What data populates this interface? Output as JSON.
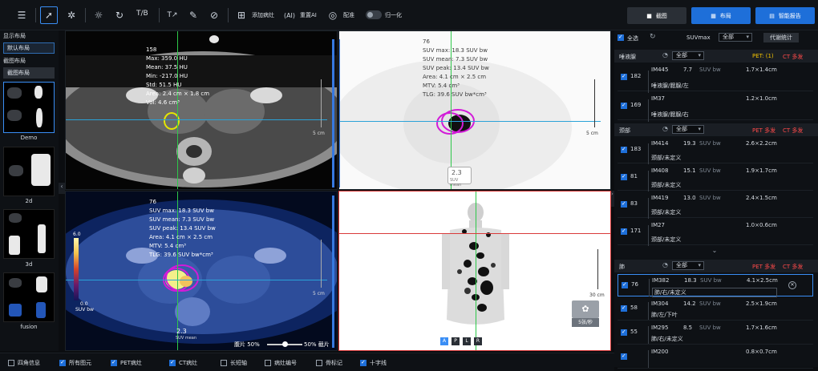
{
  "toolbar": {
    "icons": [
      "list-icon",
      "cursor-icon",
      "brightness-icon",
      "adjust-icon",
      "rotate-icon"
    ],
    "tb_label": "T/B",
    "add_lesion": "添加病灶",
    "reset_ai": "重置AI",
    "compare": "配准",
    "normalize": "归一化",
    "screenshot": "截图",
    "layout": "布局",
    "report": "智能报告",
    "colors": {
      "report_button": "#1e6fd9",
      "layout_button": "#1e6fd9",
      "dark_button": "#2a2f36"
    }
  },
  "left_panel": {
    "display_layout_title": "显示布局",
    "default_layout": "默认布局",
    "screenshot_layout_title": "截图布局",
    "screenshot_layout": "截图布局",
    "thumbs": [
      "Demo",
      "2d",
      "3d",
      "fusion"
    ]
  },
  "viewport_ct": {
    "id": "158",
    "max": "Max: 359.0 HU",
    "mean": "Mean: 37.5 HU",
    "min": "Min: -217.0 HU",
    "std": "Std: 51.5 HU",
    "area": "Area: 2.4 cm × 1.8 cm",
    "vol": "Vol: 4.6 cm³",
    "scale": "5 cm"
  },
  "viewport_pet": {
    "id": "76",
    "suv_max": "SUV max: 18.3 SUV bw",
    "suv_mean": "SUV mean: 7.3 SUV bw",
    "suv_peak": "SUV peak: 13.4 SUV bw",
    "area": "Area: 4.1 cm × 2.5 cm",
    "mtv": "MTV: 5.4 cm³",
    "tlg": "TLG: 39.6 SUV bw*cm³",
    "scale": "5 cm",
    "suv_mean_badge": "2.3",
    "suv_mean_label": "SUV mean"
  },
  "viewport_fusion": {
    "id": "76",
    "suv_max": "SUV max: 18.3 SUV bw",
    "suv_mean": "SUV mean: 7.3 SUV bw",
    "suv_peak": "SUV peak: 13.4 SUV bw",
    "area": "Area: 4.1 cm × 2.5 cm",
    "mtv": "MTV: 5.4 cm³",
    "tlg": "TLG: 39.6 SUV bw*cm³",
    "colorbar_top": "6.0",
    "colorbar_bottom": "0.0",
    "colorbar_unit": "SUV bw",
    "scale": "5 cm",
    "suv_mean_badge": "2.3",
    "suv_mean_label": "SUV mean",
    "blend_left": "腹片 50%",
    "blend_right": "50% 截片",
    "blend_value": 0.5
  },
  "viewport_mip": {
    "scale": "30 cm",
    "speed": "5张/秒",
    "views": [
      "A",
      "P",
      "L",
      "R"
    ]
  },
  "right_panel": {
    "select_all": "全选",
    "suvmax_label": "SUVmax",
    "filter_all": "全部",
    "replace_stats": "代谢统计",
    "groups": [
      {
        "name": "唾液腺",
        "filter": "全部",
        "tag": "PET: (1)",
        "tag2": "CT 多发",
        "items": [
          {
            "n": "182",
            "id": "IM445",
            "suv": "7.7",
            "unit": "SUV bw",
            "size": "1.7×1.4cm",
            "loc": "唾液腺/腮腺/左"
          },
          {
            "n": "169",
            "id": "IM37",
            "suv": "",
            "unit": "",
            "size": "1.2×1.0cm",
            "loc": "唾液腺/腮腺/右"
          }
        ]
      },
      {
        "name": "颈部",
        "filter": "全部",
        "tag": "PET 多发",
        "tag2": "CT 多发",
        "items": [
          {
            "n": "183",
            "id": "IM414",
            "suv": "19.3",
            "unit": "SUV bw",
            "size": "2.6×2.2cm",
            "loc": "颈部/未定义"
          },
          {
            "n": "81",
            "id": "IM408",
            "suv": "15.1",
            "unit": "SUV bw",
            "size": "1.9×1.7cm",
            "loc": "颈部/未定义"
          },
          {
            "n": "83",
            "id": "IM419",
            "suv": "13.0",
            "unit": "SUV bw",
            "size": "2.4×1.5cm",
            "loc": "颈部/未定义"
          },
          {
            "n": "171",
            "id": "IM27",
            "suv": "",
            "unit": "",
            "size": "1.0×0.6cm",
            "loc": "颈部/未定义"
          }
        ]
      },
      {
        "name": "肺",
        "filter": "全部",
        "tag": "PET 多发",
        "tag2": "CT 多发",
        "items": [
          {
            "n": "76",
            "id": "IM382",
            "suv": "18.3",
            "unit": "SUV bw",
            "size": "4.1×2.5cm",
            "loc": "肺/右/未定义"
          },
          {
            "n": "58",
            "id": "IM304",
            "suv": "14.2",
            "unit": "SUV bw",
            "size": "2.5×1.9cm",
            "loc": "肺/左/下叶"
          },
          {
            "n": "55",
            "id": "IM295",
            "suv": "8.5",
            "unit": "SUV bw",
            "size": "1.7×1.6cm",
            "loc": "肺/右/未定义"
          },
          {
            "n": "",
            "id": "IM200",
            "suv": "",
            "unit": "",
            "size": "0.8×0.7cm",
            "loc": ""
          }
        ]
      }
    ]
  },
  "bottom_bar": {
    "items": [
      {
        "label": "四角信息",
        "on": false
      },
      {
        "label": "所有图元",
        "on": true
      },
      {
        "label": "PET病灶",
        "on": true
      },
      {
        "label": "CT病灶",
        "on": true
      },
      {
        "label": "长短轴",
        "on": false
      },
      {
        "label": "病灶编号",
        "on": false
      },
      {
        "label": "骨标记",
        "on": false
      },
      {
        "label": "十字线",
        "on": true
      }
    ]
  }
}
